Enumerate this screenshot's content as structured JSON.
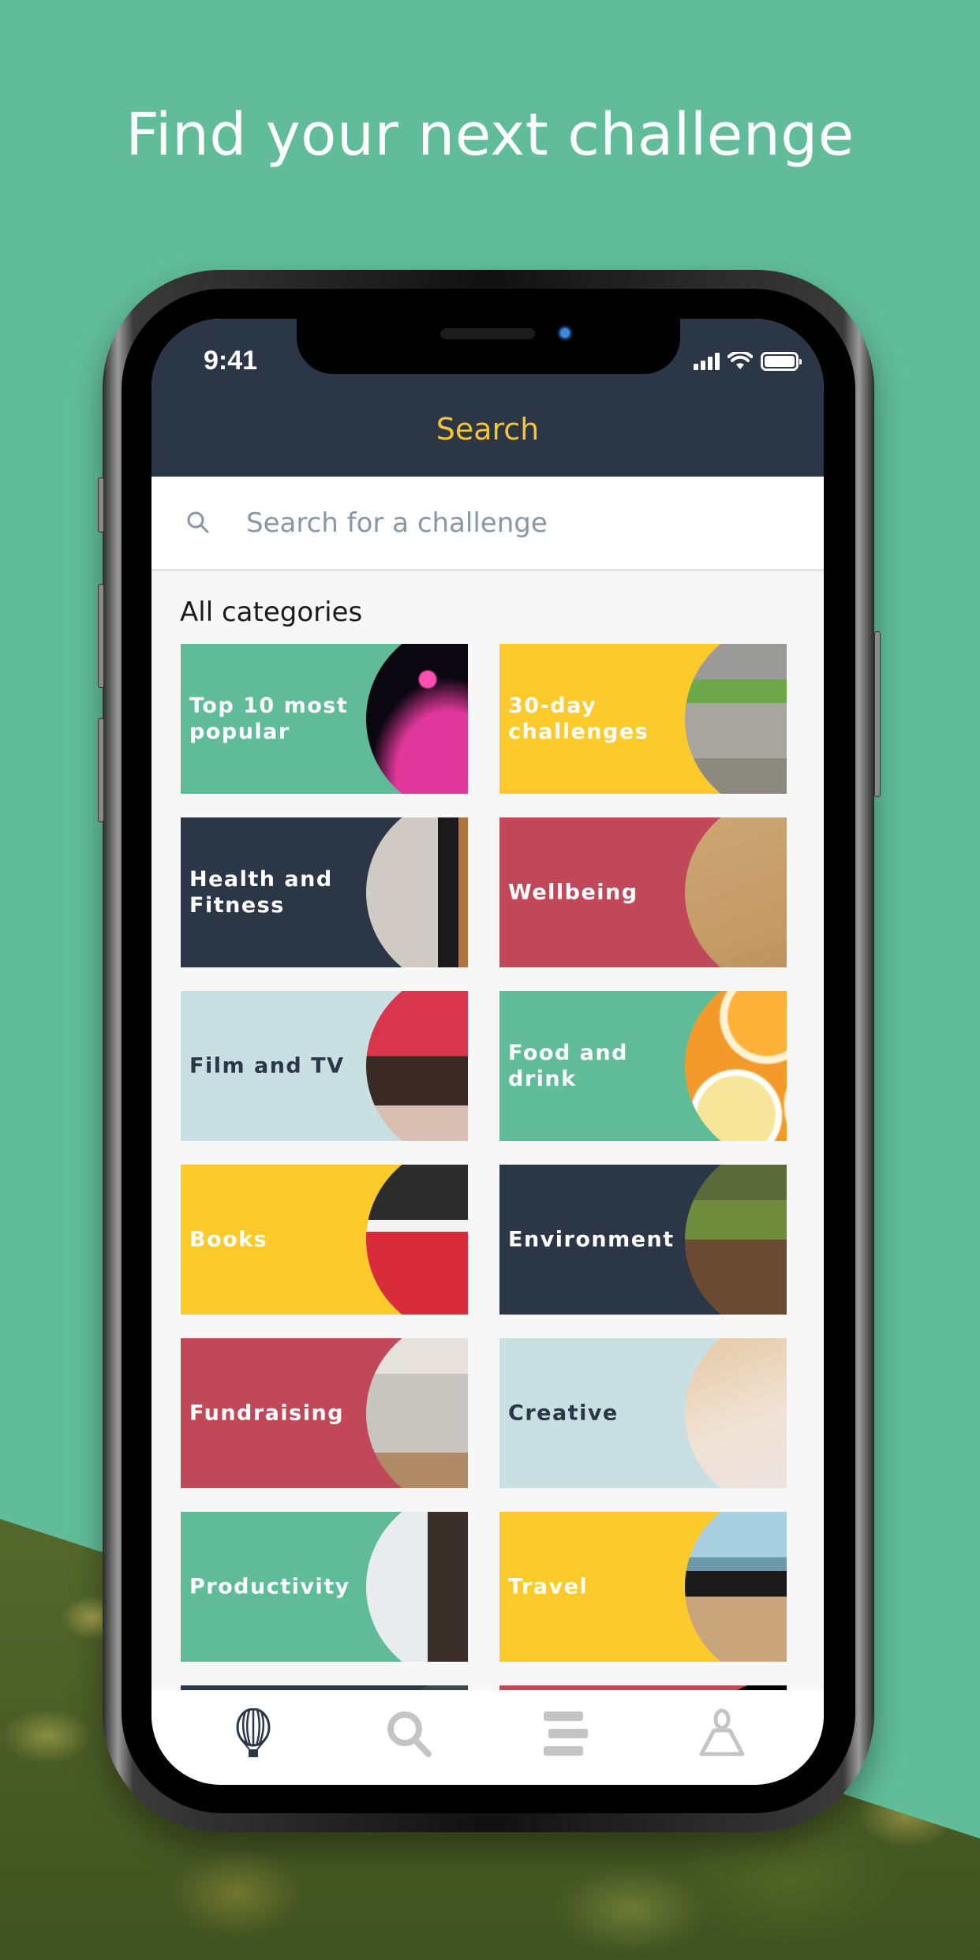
{
  "headline": "Find your next challenge",
  "status_bar": {
    "time": "9:41",
    "icons": [
      "cellular-signal-icon",
      "wifi-icon",
      "battery-icon"
    ]
  },
  "nav": {
    "title": "Search"
  },
  "search": {
    "placeholder": "Search for a challenge",
    "value": "",
    "icon": "search-icon"
  },
  "section": {
    "title": "All categories"
  },
  "categories": [
    {
      "label": "Top 10 most popular",
      "bg": "#60bc98",
      "text_color": "#ffffff",
      "image": "confetti"
    },
    {
      "label": "30-day challenges",
      "bg": "#fdca2c",
      "text_color": "#ffffff",
      "image": "people-squatting"
    },
    {
      "label": "Health and Fitness",
      "bg": "#2b3646",
      "text_color": "#ffffff",
      "image": "stretching"
    },
    {
      "label": "Wellbeing",
      "bg": "#c04859",
      "text_color": "#ffffff",
      "image": "sand-footprints"
    },
    {
      "label": "Film and TV",
      "bg": "#c9e0e2",
      "text_color": "#2b3646",
      "image": "watching-tv"
    },
    {
      "label": "Food and drink",
      "bg": "#60bc98",
      "text_color": "#ffffff",
      "image": "oranges"
    },
    {
      "label": "Books",
      "bg": "#fdca2c",
      "text_color": "#ffffff",
      "image": "reading-book"
    },
    {
      "label": "Environment",
      "bg": "#2b3646",
      "text_color": "#ffffff",
      "image": "planting"
    },
    {
      "label": "Fundraising",
      "bg": "#c04859",
      "text_color": "#ffffff",
      "image": "volunteers"
    },
    {
      "label": "Creative",
      "bg": "#c9e0e2",
      "text_color": "#2b3646",
      "image": "crafts"
    },
    {
      "label": "Productivity",
      "bg": "#60bc98",
      "text_color": "#ffffff",
      "image": "man-at-whiteboard"
    },
    {
      "label": "Travel",
      "bg": "#fdca2c",
      "text_color": "#ffffff",
      "image": "sunglasses-beach"
    }
  ],
  "partial_categories": [
    {
      "bg": "#2b3646"
    },
    {
      "bg": "#c04859"
    }
  ],
  "tab_bar": {
    "items": [
      {
        "name": "explore",
        "icon": "hot-air-balloon-icon",
        "active": true
      },
      {
        "name": "search",
        "icon": "search-icon",
        "active": false
      },
      {
        "name": "list",
        "icon": "list-icon",
        "active": false
      },
      {
        "name": "profile",
        "icon": "profile-icon",
        "active": false
      }
    ],
    "active_color": "#2b3646",
    "inactive_color": "#c4c4c4"
  },
  "colors": {
    "background": "#61bd99",
    "header": "#2b3646",
    "accent": "#f5c535"
  }
}
